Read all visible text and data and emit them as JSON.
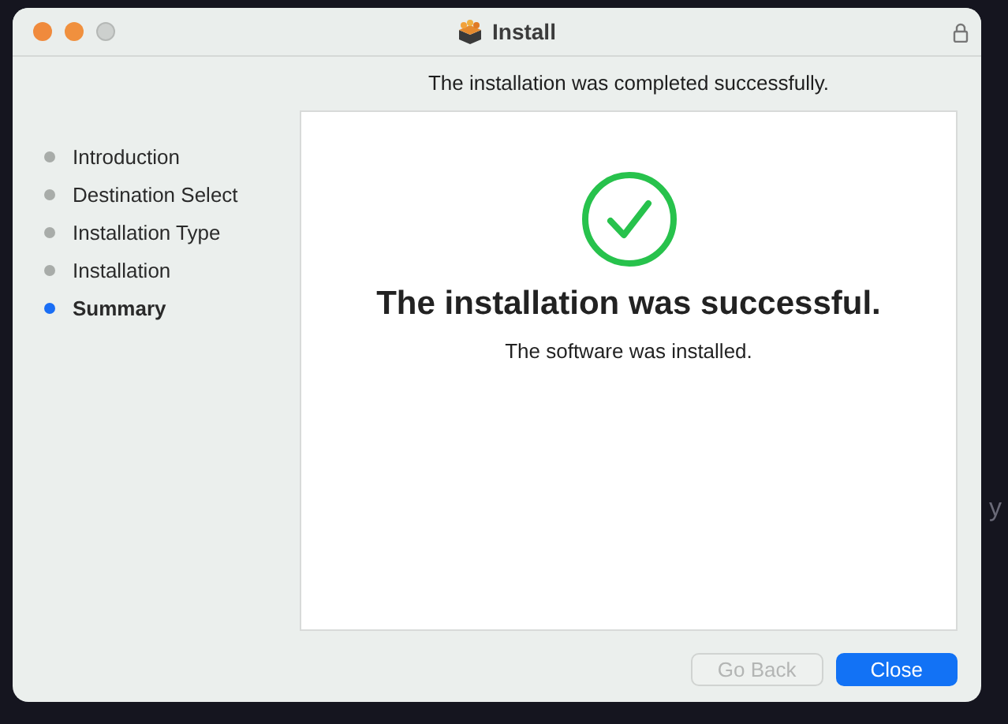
{
  "window": {
    "title": "Install"
  },
  "desktop": {
    "text": "y"
  },
  "header": "The installation was completed successfully.",
  "sidebar": {
    "items": [
      {
        "label": "Introduction",
        "selected": false
      },
      {
        "label": "Destination Select",
        "selected": false
      },
      {
        "label": "Installation Type",
        "selected": false
      },
      {
        "label": "Installation",
        "selected": false
      },
      {
        "label": "Summary",
        "selected": true
      }
    ]
  },
  "content": {
    "title": "The installation was successful.",
    "message": "The software was installed."
  },
  "buttons": [
    {
      "label": "Go Back",
      "disabled": true,
      "default": false
    },
    {
      "label": "Close",
      "disabled": false,
      "default": true
    }
  ]
}
